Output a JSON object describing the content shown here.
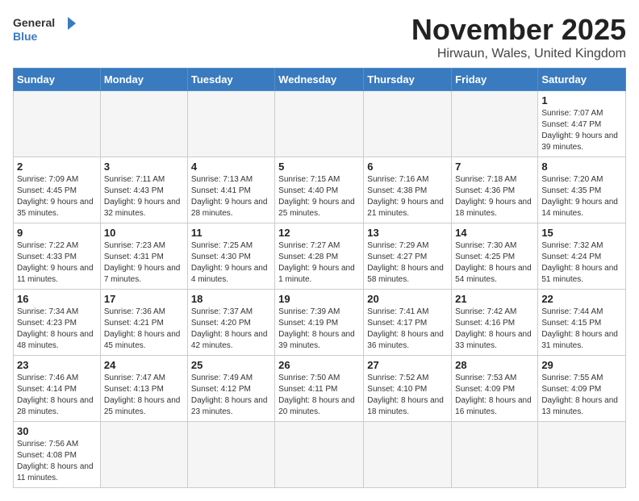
{
  "logo": {
    "line1": "General",
    "line2": "Blue"
  },
  "title": "November 2025",
  "subtitle": "Hirwaun, Wales, United Kingdom",
  "weekdays": [
    "Sunday",
    "Monday",
    "Tuesday",
    "Wednesday",
    "Thursday",
    "Friday",
    "Saturday"
  ],
  "weeks": [
    [
      {
        "day": "",
        "info": ""
      },
      {
        "day": "",
        "info": ""
      },
      {
        "day": "",
        "info": ""
      },
      {
        "day": "",
        "info": ""
      },
      {
        "day": "",
        "info": ""
      },
      {
        "day": "",
        "info": ""
      },
      {
        "day": "1",
        "info": "Sunrise: 7:07 AM\nSunset: 4:47 PM\nDaylight: 9 hours and 39 minutes."
      }
    ],
    [
      {
        "day": "2",
        "info": "Sunrise: 7:09 AM\nSunset: 4:45 PM\nDaylight: 9 hours and 35 minutes."
      },
      {
        "day": "3",
        "info": "Sunrise: 7:11 AM\nSunset: 4:43 PM\nDaylight: 9 hours and 32 minutes."
      },
      {
        "day": "4",
        "info": "Sunrise: 7:13 AM\nSunset: 4:41 PM\nDaylight: 9 hours and 28 minutes."
      },
      {
        "day": "5",
        "info": "Sunrise: 7:15 AM\nSunset: 4:40 PM\nDaylight: 9 hours and 25 minutes."
      },
      {
        "day": "6",
        "info": "Sunrise: 7:16 AM\nSunset: 4:38 PM\nDaylight: 9 hours and 21 minutes."
      },
      {
        "day": "7",
        "info": "Sunrise: 7:18 AM\nSunset: 4:36 PM\nDaylight: 9 hours and 18 minutes."
      },
      {
        "day": "8",
        "info": "Sunrise: 7:20 AM\nSunset: 4:35 PM\nDaylight: 9 hours and 14 minutes."
      }
    ],
    [
      {
        "day": "9",
        "info": "Sunrise: 7:22 AM\nSunset: 4:33 PM\nDaylight: 9 hours and 11 minutes."
      },
      {
        "day": "10",
        "info": "Sunrise: 7:23 AM\nSunset: 4:31 PM\nDaylight: 9 hours and 7 minutes."
      },
      {
        "day": "11",
        "info": "Sunrise: 7:25 AM\nSunset: 4:30 PM\nDaylight: 9 hours and 4 minutes."
      },
      {
        "day": "12",
        "info": "Sunrise: 7:27 AM\nSunset: 4:28 PM\nDaylight: 9 hours and 1 minute."
      },
      {
        "day": "13",
        "info": "Sunrise: 7:29 AM\nSunset: 4:27 PM\nDaylight: 8 hours and 58 minutes."
      },
      {
        "day": "14",
        "info": "Sunrise: 7:30 AM\nSunset: 4:25 PM\nDaylight: 8 hours and 54 minutes."
      },
      {
        "day": "15",
        "info": "Sunrise: 7:32 AM\nSunset: 4:24 PM\nDaylight: 8 hours and 51 minutes."
      }
    ],
    [
      {
        "day": "16",
        "info": "Sunrise: 7:34 AM\nSunset: 4:23 PM\nDaylight: 8 hours and 48 minutes."
      },
      {
        "day": "17",
        "info": "Sunrise: 7:36 AM\nSunset: 4:21 PM\nDaylight: 8 hours and 45 minutes."
      },
      {
        "day": "18",
        "info": "Sunrise: 7:37 AM\nSunset: 4:20 PM\nDaylight: 8 hours and 42 minutes."
      },
      {
        "day": "19",
        "info": "Sunrise: 7:39 AM\nSunset: 4:19 PM\nDaylight: 8 hours and 39 minutes."
      },
      {
        "day": "20",
        "info": "Sunrise: 7:41 AM\nSunset: 4:17 PM\nDaylight: 8 hours and 36 minutes."
      },
      {
        "day": "21",
        "info": "Sunrise: 7:42 AM\nSunset: 4:16 PM\nDaylight: 8 hours and 33 minutes."
      },
      {
        "day": "22",
        "info": "Sunrise: 7:44 AM\nSunset: 4:15 PM\nDaylight: 8 hours and 31 minutes."
      }
    ],
    [
      {
        "day": "23",
        "info": "Sunrise: 7:46 AM\nSunset: 4:14 PM\nDaylight: 8 hours and 28 minutes."
      },
      {
        "day": "24",
        "info": "Sunrise: 7:47 AM\nSunset: 4:13 PM\nDaylight: 8 hours and 25 minutes."
      },
      {
        "day": "25",
        "info": "Sunrise: 7:49 AM\nSunset: 4:12 PM\nDaylight: 8 hours and 23 minutes."
      },
      {
        "day": "26",
        "info": "Sunrise: 7:50 AM\nSunset: 4:11 PM\nDaylight: 8 hours and 20 minutes."
      },
      {
        "day": "27",
        "info": "Sunrise: 7:52 AM\nSunset: 4:10 PM\nDaylight: 8 hours and 18 minutes."
      },
      {
        "day": "28",
        "info": "Sunrise: 7:53 AM\nSunset: 4:09 PM\nDaylight: 8 hours and 16 minutes."
      },
      {
        "day": "29",
        "info": "Sunrise: 7:55 AM\nSunset: 4:09 PM\nDaylight: 8 hours and 13 minutes."
      }
    ],
    [
      {
        "day": "30",
        "info": "Sunrise: 7:56 AM\nSunset: 4:08 PM\nDaylight: 8 hours and 11 minutes."
      },
      {
        "day": "",
        "info": ""
      },
      {
        "day": "",
        "info": ""
      },
      {
        "day": "",
        "info": ""
      },
      {
        "day": "",
        "info": ""
      },
      {
        "day": "",
        "info": ""
      },
      {
        "day": "",
        "info": ""
      }
    ]
  ]
}
